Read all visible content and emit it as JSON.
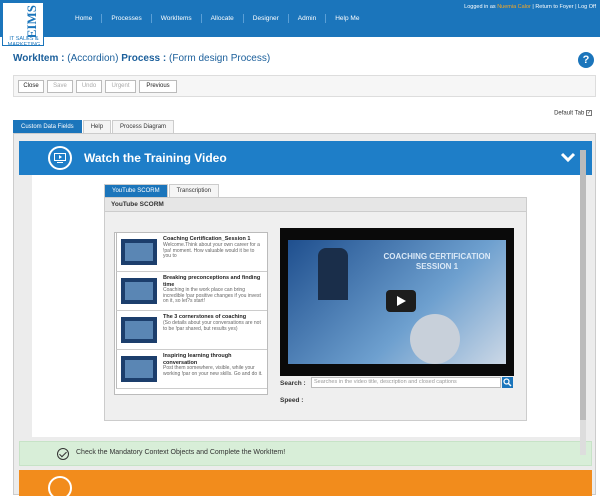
{
  "brand": {
    "name": "EIMS",
    "tagline": "IT SALES & MARKETING"
  },
  "nav": [
    "Home",
    "Processes",
    "WorkItems",
    "Allocate",
    "Designer",
    "Admin",
    "Help Me"
  ],
  "user": {
    "prefix": "Logged in as",
    "name": "Nuemia Calor",
    "links": "Return to Foyer",
    "logout": "Log Off"
  },
  "page": {
    "workitem_label": "WorkItem :",
    "workitem_value": "(Accordion)",
    "process_label": "Process :",
    "process_value": "(Form design Process)"
  },
  "toolbar": {
    "close": "Close",
    "save": "Save",
    "undo": "Undo",
    "urgent": "Urgent",
    "previous": "Previous"
  },
  "default_tab": "Default Tab",
  "tabs": [
    "Custom Data Fields",
    "Help",
    "Process Diagram"
  ],
  "accordion": {
    "title": "Watch the Training Video"
  },
  "inner_tabs": [
    "YouTube SCORM",
    "Transcription"
  ],
  "scorm": {
    "header": "YouTube SCORM",
    "items": [
      {
        "title": "Coaching Certification_Session 1",
        "desc": "Welcome.Think about your own career for a !pa! moment. How valuable would it be to you to"
      },
      {
        "title": "Breaking preconceptions and finding time",
        "desc": "Coaching in the work place can bring incredible !par positive changes if you invest on it, so let?s start!"
      },
      {
        "title": "The 3 cornerstones of coaching",
        "desc": "(So details about your conversations are not to be !par shared, but results yes)"
      },
      {
        "title": "Inspiring learning through conversation",
        "desc": "Post them somewhere, visible, while your working !par on your new skills. Go and do it."
      }
    ],
    "video_text": "COACHING CERTIFICATION SESSION 1",
    "search_label": "Search :",
    "search_placeholder": "Searches in the video title, description and closed captions",
    "speed_label": "Speed :"
  },
  "check": {
    "text": "Check the Mandatory Context Objects and Complete the WorkItem!"
  }
}
